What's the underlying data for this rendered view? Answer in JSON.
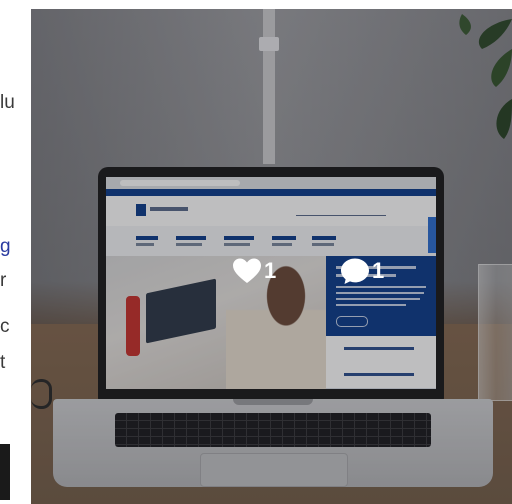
{
  "left_column": {
    "fragments": [
      "lu",
      "g",
      "r",
      "c",
      "t"
    ]
  },
  "post": {
    "likes_count": "1",
    "comments_count": "1",
    "like_icon": "heart-icon",
    "comment_icon": "speech-bubble-icon"
  },
  "colors": {
    "overlay": "#141418",
    "stat_text": "#ffffff",
    "site_brand": "#0e3d8c",
    "link": "#2a3aa0"
  }
}
